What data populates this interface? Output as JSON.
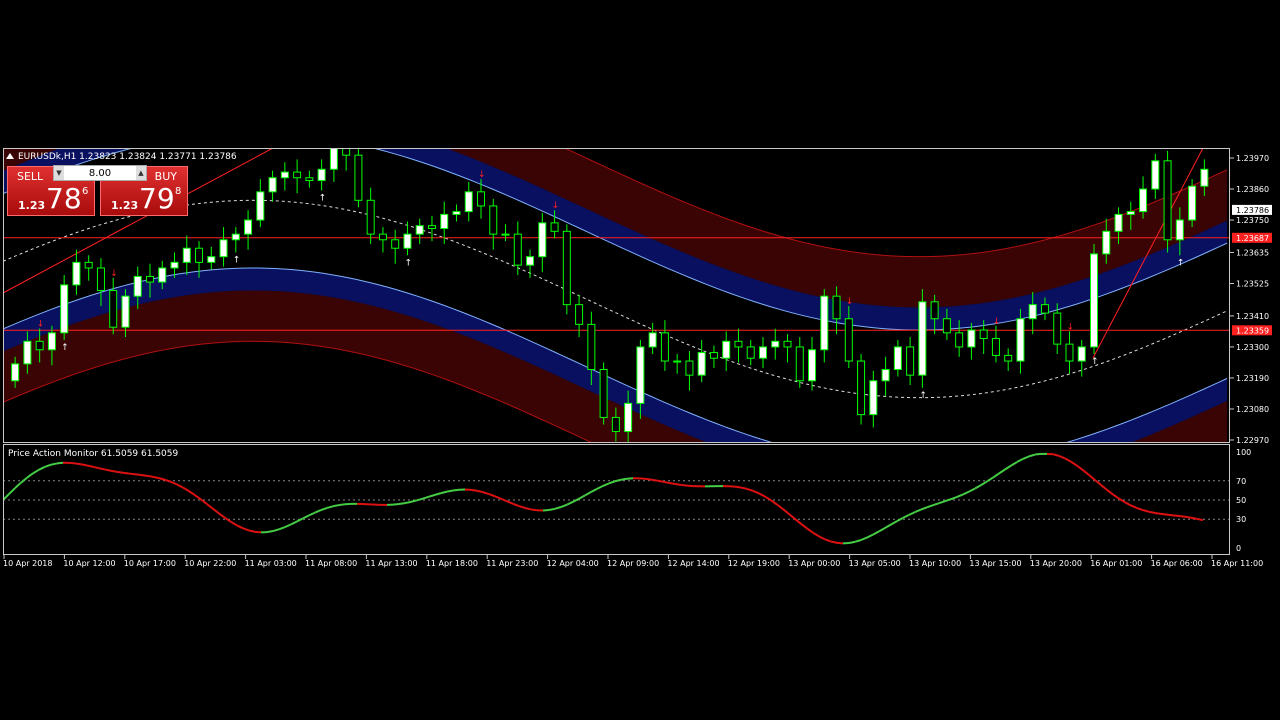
{
  "symbol_header": "EURUSDk,H1  1.23823 1.23824 1.23771 1.23786",
  "trade_panel": {
    "sell_label": "SELL",
    "buy_label": "BUY",
    "lot": "8.00",
    "sell_prefix": "1.23",
    "sell_big": "78",
    "sell_sup": "6",
    "buy_prefix": "1.23",
    "buy_big": "79",
    "buy_sup": "8"
  },
  "price_axis": [
    "1.23970",
    "1.23860",
    "1.23750",
    "1.23635",
    "1.23525",
    "1.23410",
    "1.23300",
    "1.23190",
    "1.23080",
    "1.22970"
  ],
  "current_price_label": "1.23786",
  "line_labels": [
    "1.23687",
    "1.23359"
  ],
  "indicator": {
    "title": "Price Action Monitor 61.5059 61.5059",
    "levels": [
      "100",
      "70",
      "50",
      "30",
      "0"
    ]
  },
  "time_axis": [
    "10 Apr 2018",
    "10 Apr 12:00",
    "10 Apr 17:00",
    "10 Apr 22:00",
    "11 Apr 03:00",
    "11 Apr 08:00",
    "11 Apr 13:00",
    "11 Apr 18:00",
    "11 Apr 23:00",
    "12 Apr 04:00",
    "12 Apr 09:00",
    "12 Apr 14:00",
    "12 Apr 19:00",
    "13 Apr 00:00",
    "13 Apr 05:00",
    "13 Apr 10:00",
    "13 Apr 15:00",
    "13 Apr 20:00",
    "16 Apr 01:00",
    "16 Apr 06:00",
    "16 Apr 11:00"
  ],
  "colors": {
    "bull": "#ffffff",
    "bear": "#000000",
    "wick": "#00ff00",
    "band_outer": "#3a0404",
    "band_inner": "#0a1060",
    "line_red": "#ff2020",
    "osc_up": "#44cc44",
    "osc_down": "#dd1111"
  },
  "chart_data": {
    "type": "candlestick",
    "close": [
      1.2324,
      1.2332,
      1.2329,
      1.2335,
      1.2352,
      1.236,
      1.2358,
      1.235,
      1.2337,
      1.2348,
      1.2355,
      1.2353,
      1.2358,
      1.236,
      1.2365,
      1.236,
      1.2362,
      1.2368,
      1.237,
      1.2375,
      1.2385,
      1.239,
      1.2392,
      1.239,
      1.2389,
      1.2393,
      1.2401,
      1.2398,
      1.2382,
      1.237,
      1.2368,
      1.2365,
      1.237,
      1.2373,
      1.2372,
      1.2377,
      1.2378,
      1.2385,
      1.238,
      1.237,
      1.237,
      1.2359,
      1.2362,
      1.2374,
      1.2371,
      1.2345,
      1.2338,
      1.2322,
      1.2305,
      1.23,
      1.231,
      1.233,
      1.2335,
      1.2325,
      1.2325,
      1.232,
      1.2328,
      1.2326,
      1.2332,
      1.233,
      1.2326,
      1.233,
      1.2332,
      1.233,
      1.2318,
      1.2329,
      1.2348,
      1.234,
      1.2325,
      1.2306,
      1.2318,
      1.2322,
      1.233,
      1.232,
      1.2346,
      1.234,
      1.2335,
      1.233,
      1.2336,
      1.2333,
      1.2327,
      1.2325,
      1.234,
      1.2345,
      1.2342,
      1.2331,
      1.2325,
      1.233,
      1.2363,
      1.2371,
      1.2377,
      1.2378,
      1.2386,
      1.2396,
      1.2368,
      1.2375,
      1.2387,
      1.2393
    ],
    "x_start": "10 Apr 2018",
    "x_step_hours": 1
  }
}
